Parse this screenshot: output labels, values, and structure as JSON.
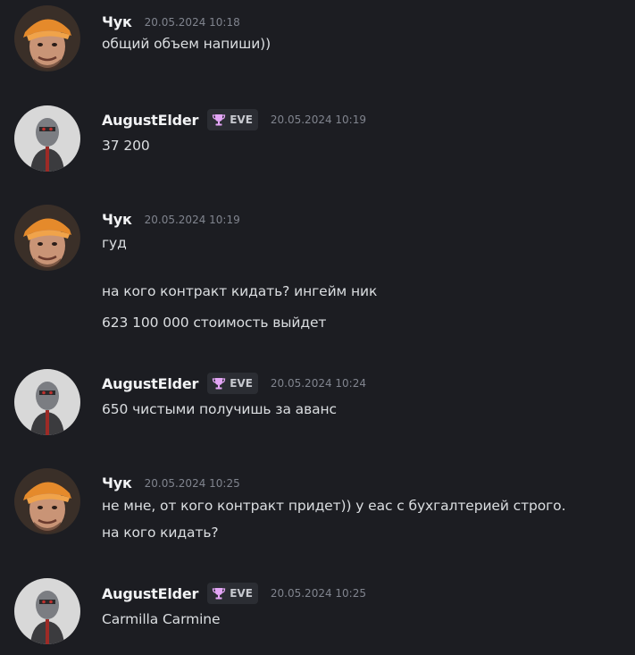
{
  "colors": {
    "background": "#1c1d22",
    "username": "#f2f3f5",
    "timestamp": "#80848e",
    "text": "#dbdee1",
    "badge_bg": "#2b2d33",
    "trophy": "#e3a5f5"
  },
  "badge_icon": "trophy-icon",
  "messages": [
    {
      "author": "Чук",
      "timestamp": "20.05.2024 10:18",
      "avatar": "chuk",
      "badge": null,
      "lines": [
        "общий объем напиши))"
      ]
    },
    {
      "author": "AugustElder",
      "timestamp": "20.05.2024 10:19",
      "avatar": "robot",
      "badge": "EVE",
      "lines": [
        "37 200"
      ]
    },
    {
      "author": "Чук",
      "timestamp": "20.05.2024 10:19",
      "avatar": "chuk",
      "badge": null,
      "lines": [
        "гуд",
        "на кого контракт кидать? ингейм ник",
        "623 100 000 стоимость выйдет"
      ]
    },
    {
      "author": "AugustElder",
      "timestamp": "20.05.2024 10:24",
      "avatar": "robot",
      "badge": "EVE",
      "lines": [
        "650 чистыми получишь за аванс"
      ]
    },
    {
      "author": "Чук",
      "timestamp": "20.05.2024 10:25",
      "avatar": "chuk",
      "badge": null,
      "lines": [
        "не мне, от кого контракт придет)) у еас с бухгалтерией строго.",
        "на кого кидать?"
      ]
    },
    {
      "author": "AugustElder",
      "timestamp": "20.05.2024 10:25",
      "avatar": "robot",
      "badge": "EVE",
      "lines": [
        "Carmilla Carmine"
      ]
    }
  ]
}
